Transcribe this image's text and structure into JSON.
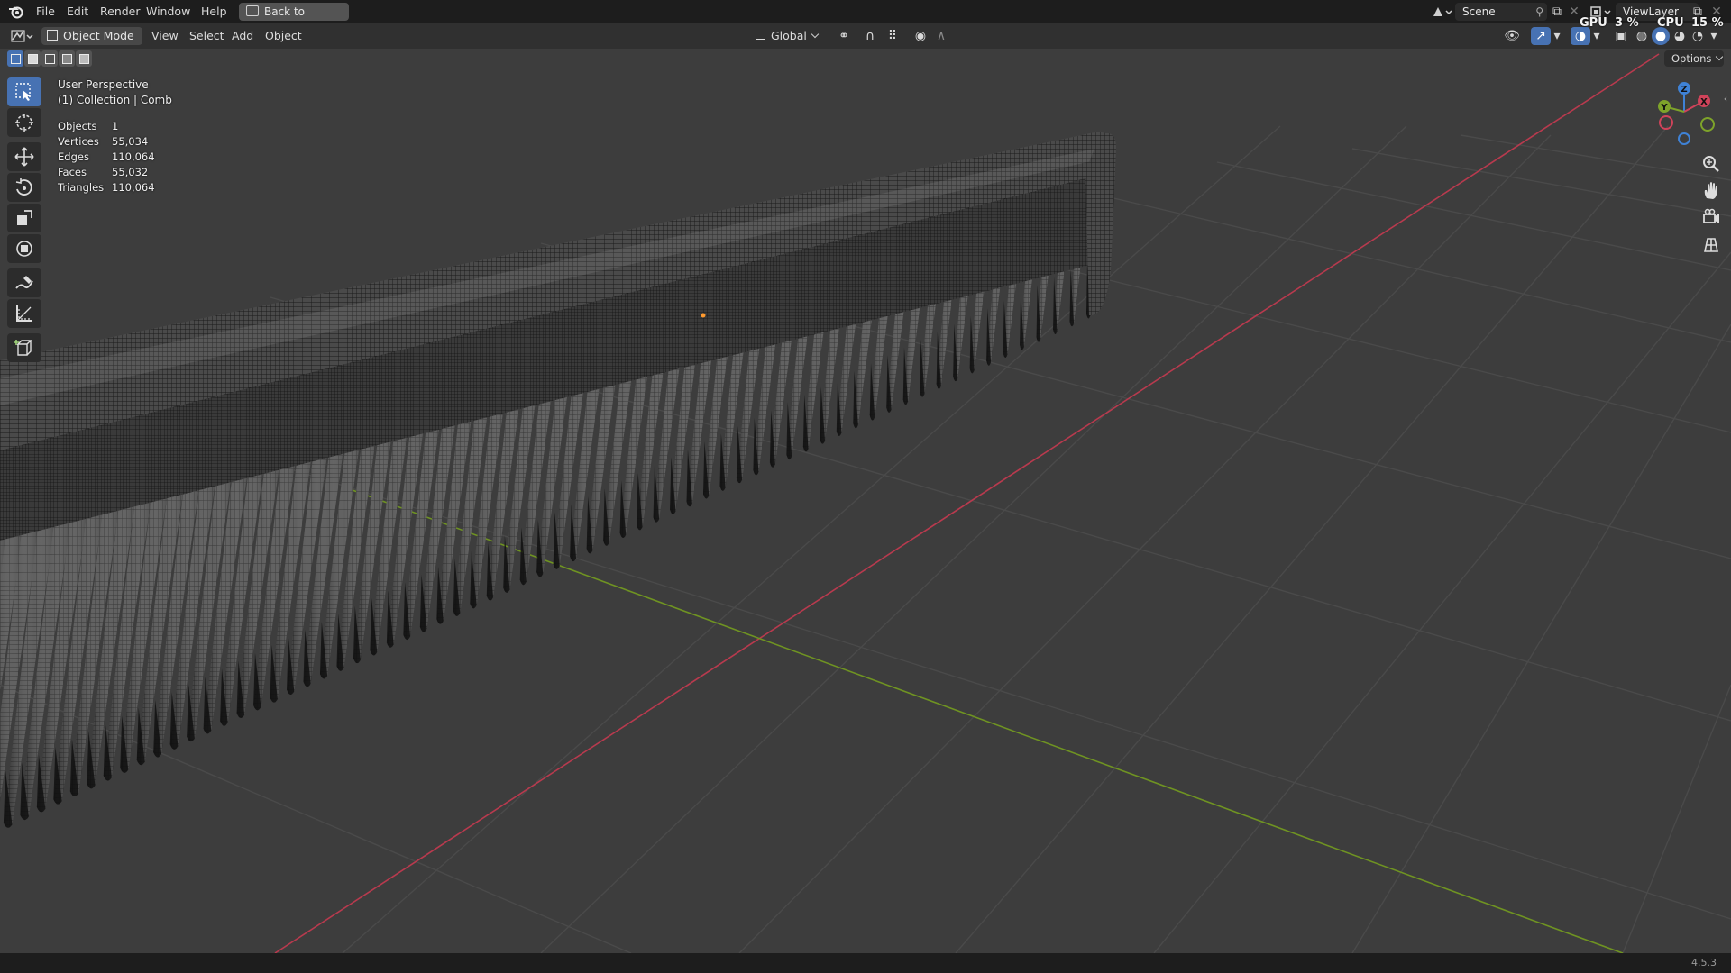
{
  "menubar": {
    "items": [
      "File",
      "Edit",
      "Render",
      "Window",
      "Help"
    ],
    "back_button": "Back to Previous",
    "scene": "Scene",
    "view_layer": "ViewLayer",
    "gpu_label": "GPU",
    "gpu_value": "3 %",
    "cpu_label": "CPU",
    "cpu_value": "15 %"
  },
  "header": {
    "mode": "Object Mode",
    "menus": [
      "View",
      "Select",
      "Add",
      "Object"
    ],
    "transform_orientation": "Global"
  },
  "viewport": {
    "view_name": "User Perspective",
    "collection": "(1) Collection | Comb",
    "options_label": "Options",
    "stats": [
      {
        "label": "Objects",
        "value": "1"
      },
      {
        "label": "Vertices",
        "value": "55,034"
      },
      {
        "label": "Edges",
        "value": "110,064"
      },
      {
        "label": "Faces",
        "value": "55,032"
      },
      {
        "label": "Triangles",
        "value": "110,064"
      }
    ],
    "gizmo": {
      "x": "X",
      "y": "Y",
      "z": "Z"
    }
  },
  "tools": [
    "select-box-icon",
    "cursor-icon",
    "move-icon",
    "rotate-icon",
    "scale-icon",
    "transform-icon",
    "annotate-icon",
    "measure-icon",
    "add-cube-icon"
  ],
  "statusbar": {
    "version": "4.5.3"
  },
  "colors": {
    "accent": "#4772b3",
    "axis_x": "#d0435a",
    "axis_y": "#7ea32a",
    "axis_z": "#3f82d6",
    "background": "#3d3d3d"
  }
}
